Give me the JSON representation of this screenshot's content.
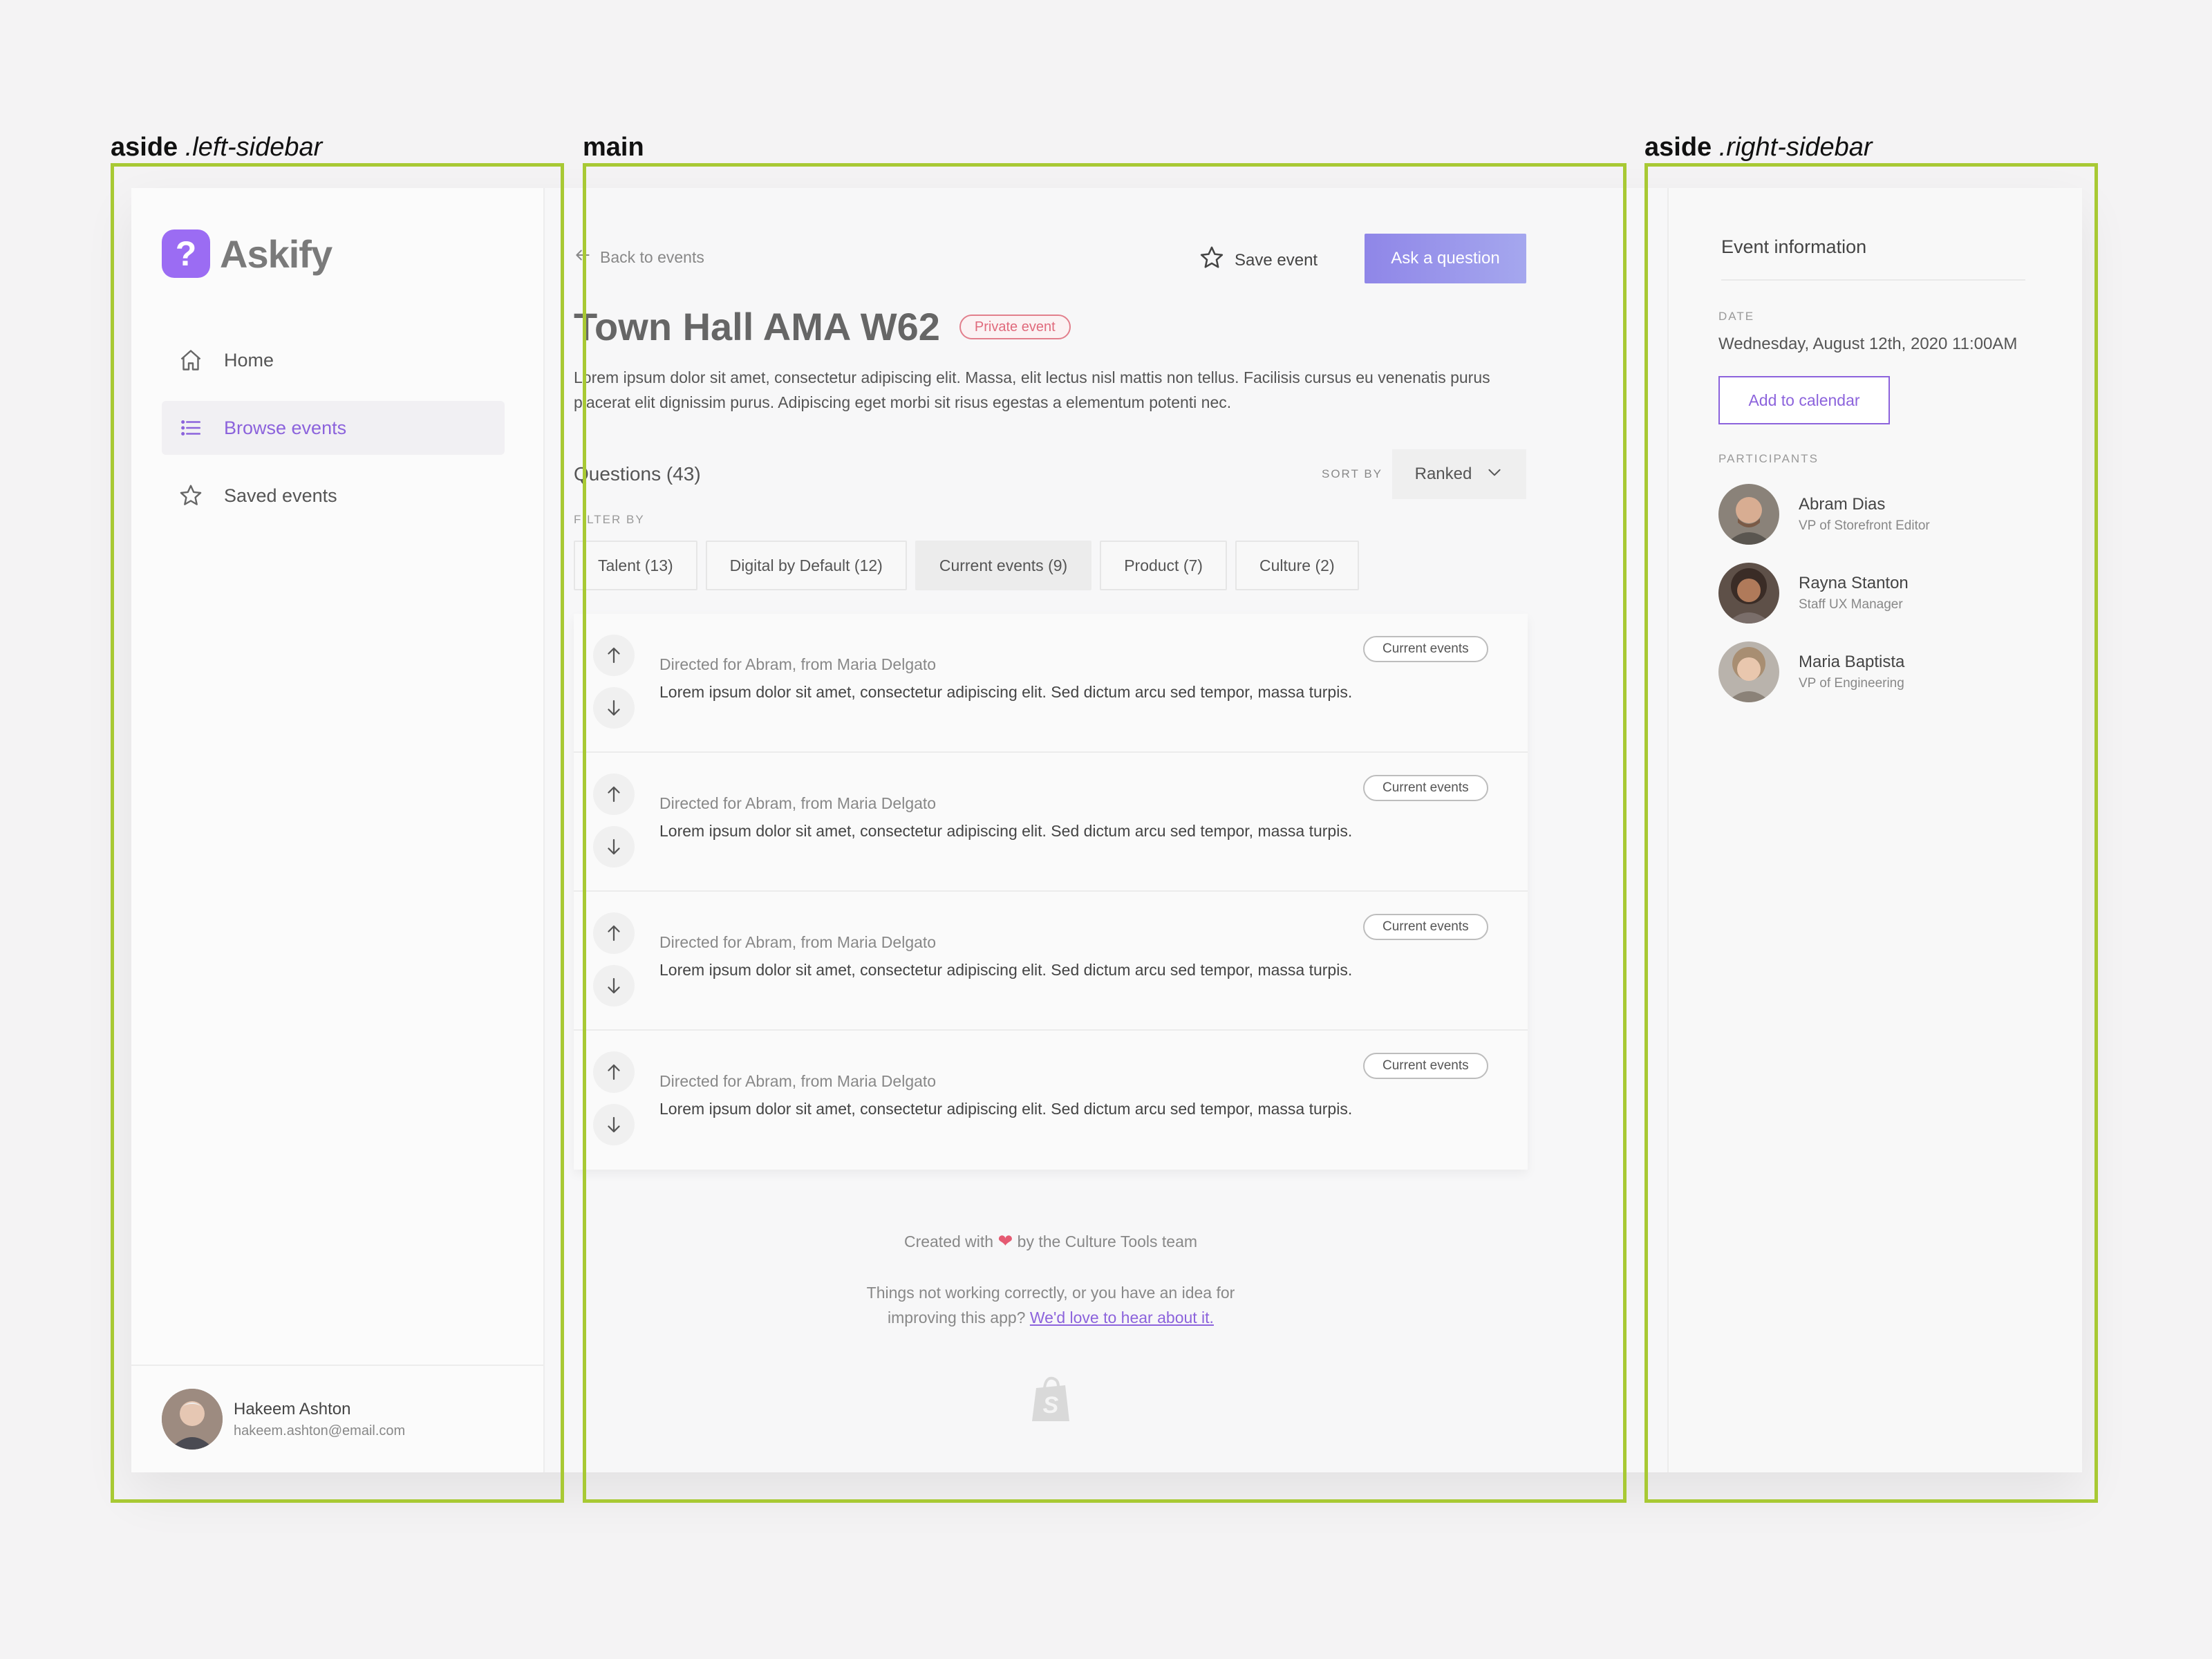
{
  "annotations": {
    "left": {
      "tag": "aside",
      "class": ".left-sidebar"
    },
    "main": {
      "tag": "main"
    },
    "right": {
      "tag": "aside",
      "class": ".right-sidebar"
    }
  },
  "brand": {
    "name": "Askify",
    "mark": "?",
    "color": "#9b6cf3"
  },
  "nav": [
    {
      "label": "Home",
      "icon": "home-icon",
      "active": false
    },
    {
      "label": "Browse events",
      "icon": "list-icon",
      "active": true
    },
    {
      "label": "Saved events",
      "icon": "star-icon",
      "active": false
    }
  ],
  "user": {
    "name": "Hakeem Ashton",
    "email": "hakeem.ashton@email.com"
  },
  "topbar": {
    "back": "Back to events",
    "save": "Save event",
    "ask": "Ask a question"
  },
  "event": {
    "title": "Town Hall AMA W62",
    "badge": "Private event",
    "description": "Lorem ipsum dolor sit amet, consectetur adipiscing elit. Massa, elit lectus nisl mattis non tellus. Facilisis cursus eu venenatis purus placerat elit dignissim purus. Adipiscing eget morbi sit risus egestas a elementum potenti nec."
  },
  "questions": {
    "heading": "Questions (43)",
    "sort_label": "SORT BY",
    "sort_value": "Ranked",
    "filter_label": "FILTER BY",
    "filters": [
      {
        "label": "Talent (13)",
        "active": false
      },
      {
        "label": "Digital by Default (12)",
        "active": false
      },
      {
        "label": "Current events (9)",
        "active": true
      },
      {
        "label": "Product (7)",
        "active": false
      },
      {
        "label": "Culture (2)",
        "active": false
      }
    ],
    "items": [
      {
        "meta": "Directed for Abram, from Maria Delgato",
        "text": "Lorem ipsum dolor sit amet, consectetur adipiscing elit. Sed dictum arcu sed tempor, massa turpis.",
        "tag": "Current events"
      },
      {
        "meta": "Directed for Abram, from Maria Delgato",
        "text": "Lorem ipsum dolor sit amet, consectetur adipiscing elit. Sed dictum arcu sed tempor, massa turpis.",
        "tag": "Current events"
      },
      {
        "meta": "Directed for Abram, from Maria Delgato",
        "text": "Lorem ipsum dolor sit amet, consectetur adipiscing elit. Sed dictum arcu sed tempor, massa turpis.",
        "tag": "Current events"
      },
      {
        "meta": "Directed for Abram, from Maria Delgato",
        "text": "Lorem ipsum dolor sit amet, consectetur adipiscing elit. Sed dictum arcu sed tempor, massa turpis.",
        "tag": "Current events"
      }
    ]
  },
  "footer": {
    "created_pre": "Created with",
    "created_post": "by the Culture Tools team",
    "feedback_pre": "Things not working correctly, or you have an idea for",
    "feedback_mid": "improving this app?",
    "feedback_link": "We'd love to hear about it."
  },
  "info": {
    "title": "Event information",
    "date_label": "DATE",
    "date": "Wednesday, August 12th, 2020 11:00AM",
    "calendar": "Add to calendar",
    "participants_label": "PARTICIPANTS",
    "participants": [
      {
        "name": "Abram Dias",
        "role": "VP of Storefront Editor"
      },
      {
        "name": "Rayna Stanton",
        "role": "Staff UX Manager"
      },
      {
        "name": "Maria Baptista",
        "role": "VP of Engineering"
      }
    ]
  },
  "colors": {
    "accent": "#8c63dc",
    "annotation": "#a8c934",
    "badge": "#e06a7c"
  }
}
